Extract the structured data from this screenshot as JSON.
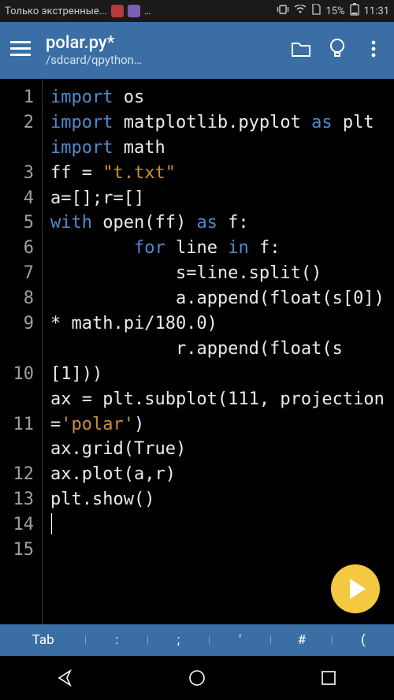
{
  "status": {
    "left_text": "Только экстренные...",
    "battery_pct": "15%",
    "clock": "11:31"
  },
  "header": {
    "title": "polar.py*",
    "subtitle": "/sdcard/qpython…"
  },
  "code": {
    "lines": [
      {
        "n": "1",
        "wrap": 0,
        "tokens": [
          [
            "kw",
            "import"
          ],
          [
            "plain",
            " os"
          ]
        ]
      },
      {
        "n": "2",
        "wrap": 1,
        "tokens": [
          [
            "kw",
            "import"
          ],
          [
            "plain",
            " matplotlib.pyplot "
          ],
          [
            "kw",
            "as"
          ],
          [
            "plain",
            " plt"
          ]
        ]
      },
      {
        "n": "3",
        "wrap": 0,
        "tokens": [
          [
            "kw",
            "import"
          ],
          [
            "plain",
            " math"
          ]
        ]
      },
      {
        "n": "4",
        "wrap": 0,
        "tokens": [
          [
            "plain",
            "ff = "
          ],
          [
            "str",
            "\"t.txt\""
          ]
        ]
      },
      {
        "n": "5",
        "wrap": 0,
        "tokens": [
          [
            "plain",
            "a=[];r=[]"
          ]
        ]
      },
      {
        "n": "6",
        "wrap": 0,
        "tokens": [
          [
            "kw",
            "with"
          ],
          [
            "plain",
            " open(ff) "
          ],
          [
            "kw",
            "as"
          ],
          [
            "plain",
            " f:"
          ]
        ]
      },
      {
        "n": "7",
        "wrap": 0,
        "tokens": [
          [
            "plain",
            "        "
          ],
          [
            "kw",
            "for"
          ],
          [
            "plain",
            " line "
          ],
          [
            "kw",
            "in"
          ],
          [
            "plain",
            " f:"
          ]
        ]
      },
      {
        "n": "8",
        "wrap": 0,
        "tokens": [
          [
            "plain",
            "            s=line.split()"
          ]
        ]
      },
      {
        "n": "9",
        "wrap": 1,
        "tokens": [
          [
            "plain",
            "            a.append(float(s[0])* math.pi/180.0)"
          ]
        ]
      },
      {
        "n": "10",
        "wrap": 1,
        "tokens": [
          [
            "plain",
            "            r.append(float(s[1]))"
          ]
        ]
      },
      {
        "n": "11",
        "wrap": 1,
        "tokens": [
          [
            "plain",
            "ax = plt.subplot(111, projection="
          ],
          [
            "str",
            "'polar'"
          ],
          [
            "plain",
            ")"
          ]
        ]
      },
      {
        "n": "12",
        "wrap": 0,
        "tokens": [
          [
            "plain",
            "ax.grid(True)"
          ]
        ]
      },
      {
        "n": "13",
        "wrap": 0,
        "tokens": [
          [
            "plain",
            "ax.plot(a,r)"
          ]
        ]
      },
      {
        "n": "14",
        "wrap": 0,
        "tokens": [
          [
            "plain",
            "plt.show()"
          ]
        ]
      },
      {
        "n": "15",
        "wrap": 0,
        "tokens": [
          [
            "plain",
            ""
          ]
        ],
        "cursor": true
      }
    ]
  },
  "kbd": {
    "keys": [
      "Tab",
      ":",
      ";",
      "'",
      "#",
      "("
    ]
  },
  "icons": {
    "folder": "folder-icon",
    "bulb": "bulb-icon",
    "more": "more-icon"
  }
}
